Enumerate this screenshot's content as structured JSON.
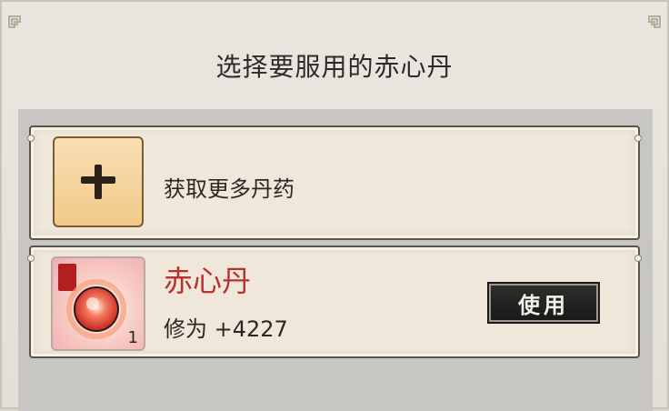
{
  "dialog": {
    "title": "选择要服用的赤心丹"
  },
  "get_more": {
    "icon": "plus-icon",
    "label": "获取更多丹药"
  },
  "item": {
    "icon": "red-pill-icon",
    "name": "赤心丹",
    "count": "1",
    "stat": "修为 +4227",
    "use_label": "使用",
    "name_color": "#b9302d"
  }
}
